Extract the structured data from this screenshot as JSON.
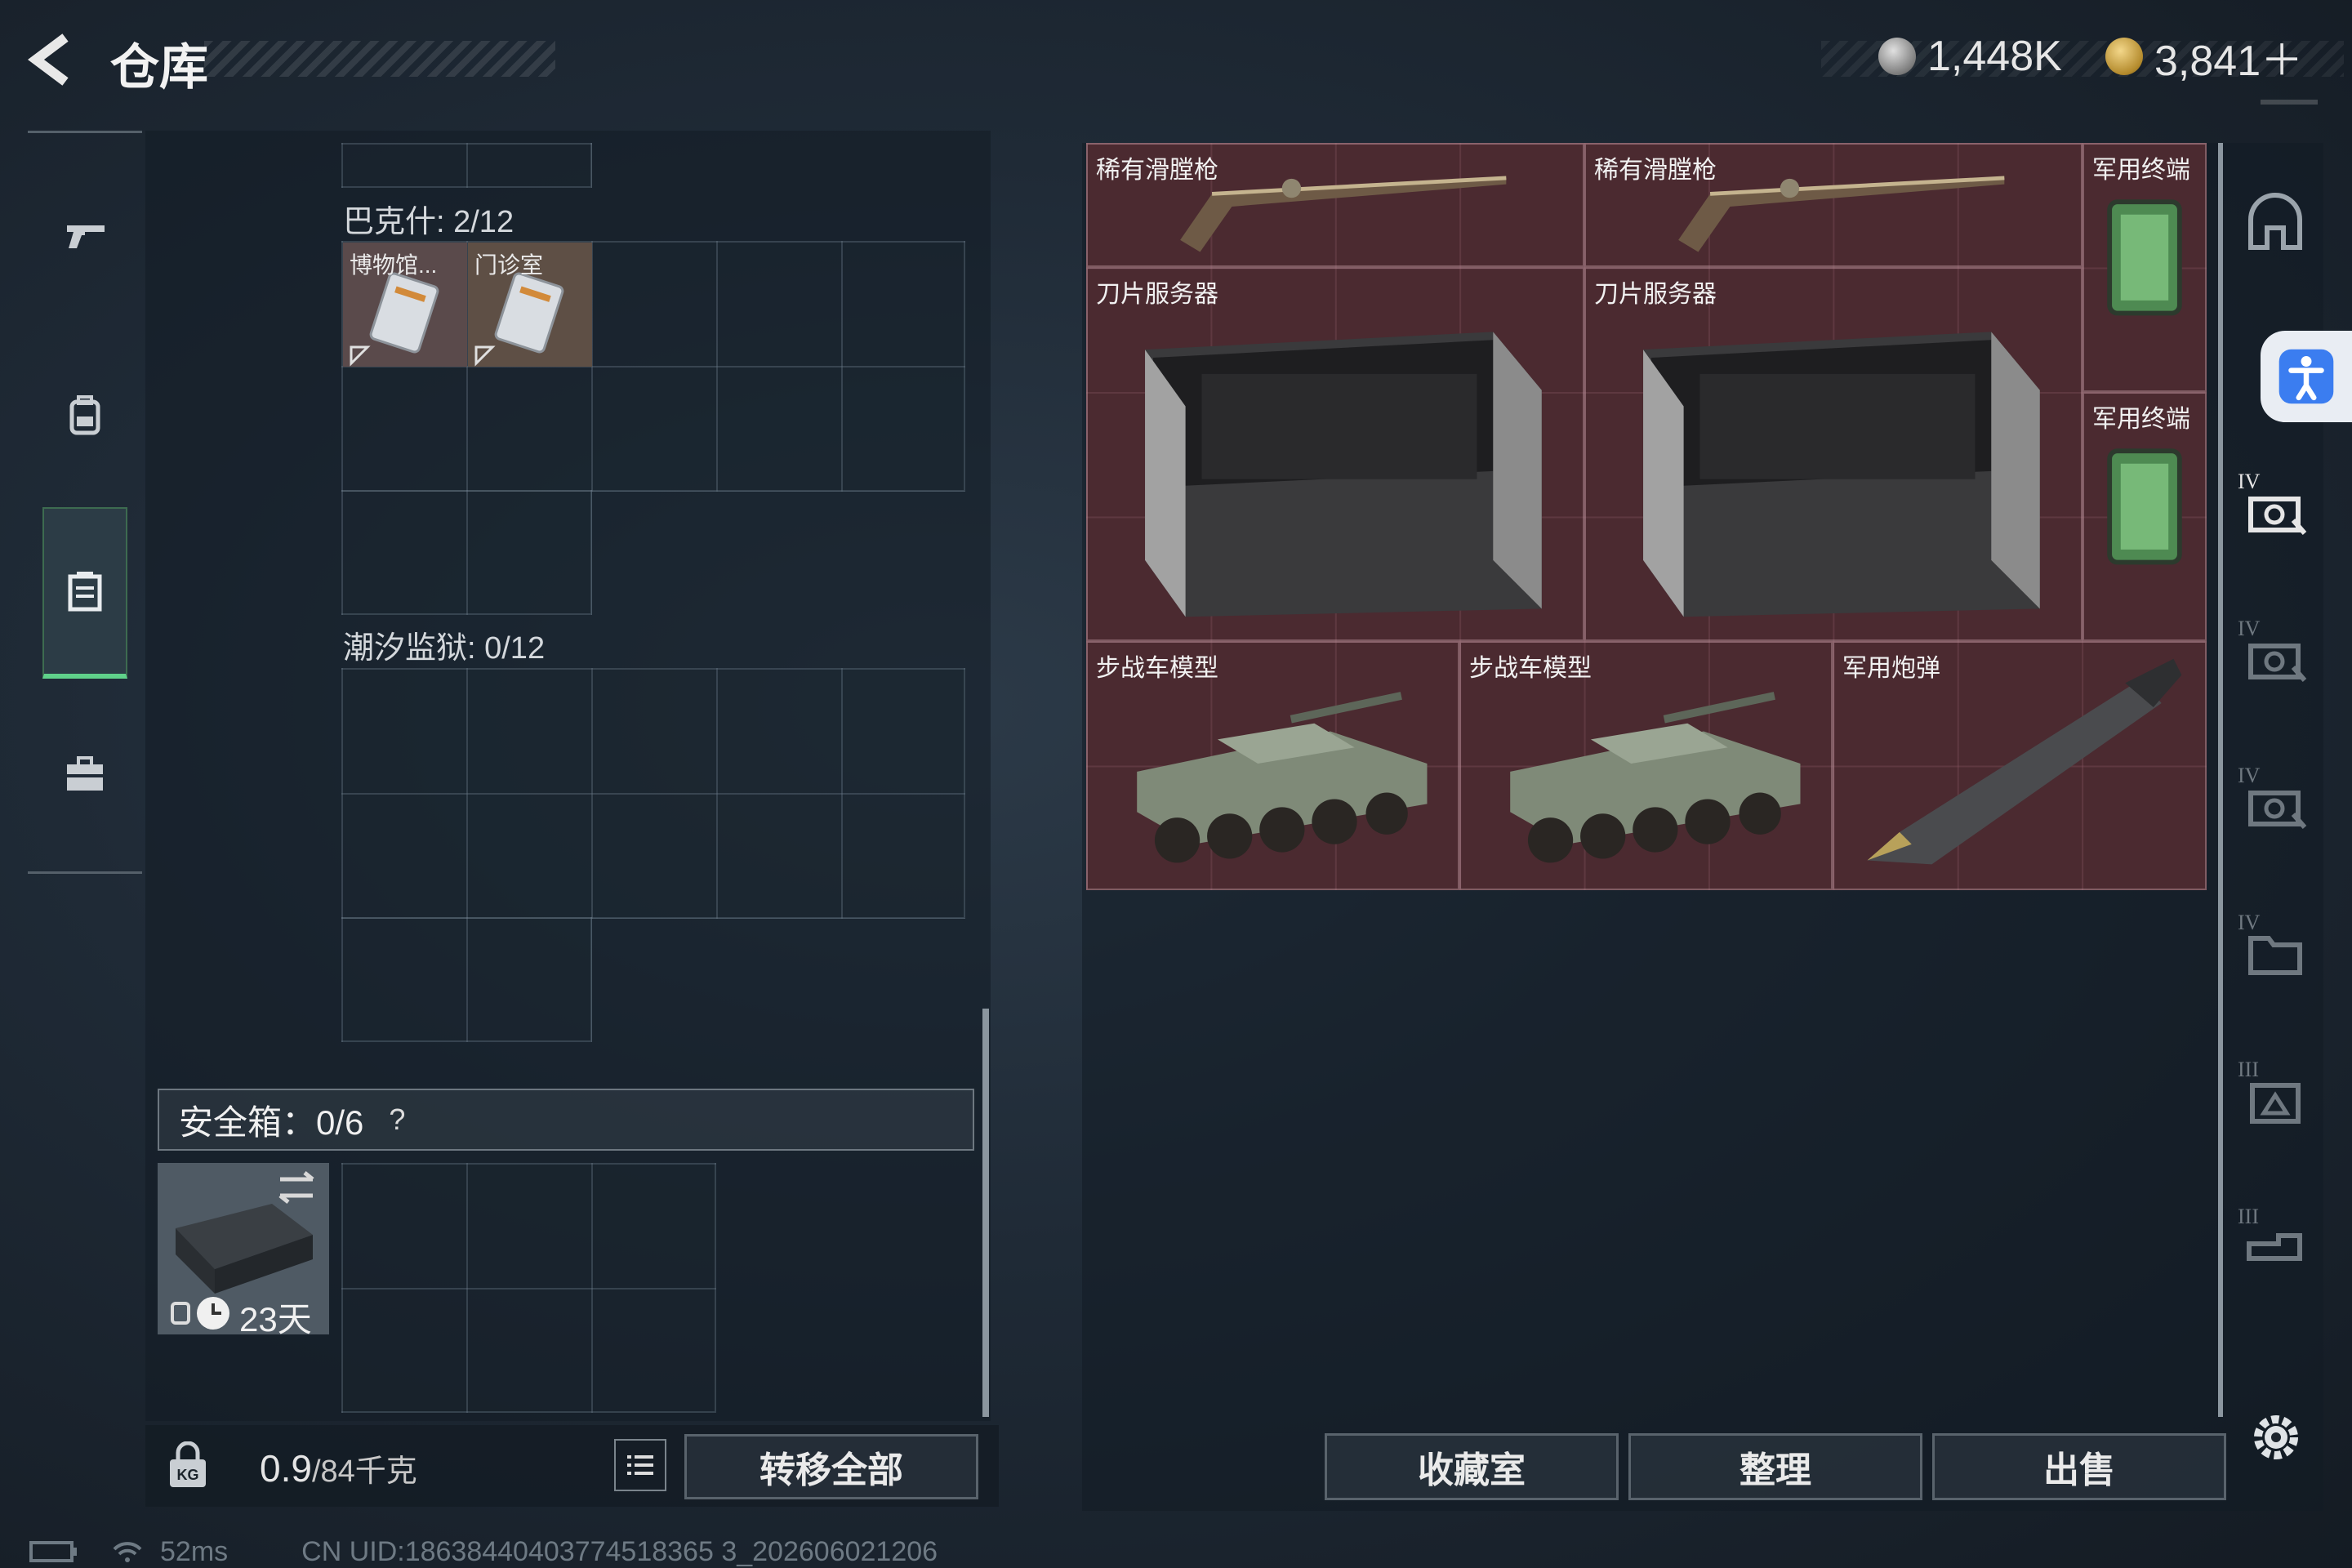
{
  "header": {
    "title": "仓库",
    "currencies": [
      {
        "icon": "silver-coin-icon",
        "value": "1,448K"
      },
      {
        "icon": "gold-coin-icon",
        "value": "3,841＋"
      }
    ]
  },
  "left_nav": {
    "items": [
      {
        "name": "weapons",
        "icon": "pistol-icon"
      },
      {
        "name": "backpack",
        "icon": "backpack-icon"
      },
      {
        "name": "containers",
        "icon": "container-icon",
        "active": true
      },
      {
        "name": "briefcase",
        "icon": "briefcase-icon"
      }
    ]
  },
  "containers": [
    {
      "label": "巴克什: 2/12",
      "items": [
        {
          "label": "博物馆...",
          "icon": "keycard-icon"
        },
        {
          "label": "门诊室",
          "icon": "keycard-icon"
        }
      ]
    },
    {
      "label": "潮汐监狱: 0/12",
      "items": []
    }
  ],
  "safe_box": {
    "label": "安全箱：0/6",
    "help": "?",
    "duration": "23天"
  },
  "weight": {
    "value": "0.9",
    "unit": "/84千克"
  },
  "buttons": {
    "transfer_all": "转移全部",
    "collection": "收藏室",
    "sort": "整理",
    "sell": "出售"
  },
  "storage_items": [
    {
      "label": "稀有滑膛枪",
      "icon": "musket-icon"
    },
    {
      "label": "稀有滑膛枪",
      "icon": "musket-icon"
    },
    {
      "label": "军用终端",
      "icon": "terminal-icon"
    },
    {
      "label": "刀片服务器",
      "icon": "blade-server-icon"
    },
    {
      "label": "刀片服务器",
      "icon": "blade-server-icon"
    },
    {
      "label": "军用终端",
      "icon": "terminal-icon"
    },
    {
      "label": "步战车模型",
      "icon": "ifv-model-icon"
    },
    {
      "label": "步战车模型",
      "icon": "ifv-model-icon"
    },
    {
      "label": "军用炮弹",
      "icon": "artillery-shell-icon"
    }
  ],
  "side_tabs": [
    {
      "tier": "",
      "icon": "helmet-tab-icon"
    },
    {
      "tier": "IV",
      "icon": "tier-tab-icon"
    },
    {
      "tier": "IV",
      "icon": "camera-tab-icon"
    },
    {
      "tier": "IV",
      "icon": "camera-tab-icon"
    },
    {
      "tier": "IV",
      "icon": "camera-tab-icon"
    },
    {
      "tier": "IV",
      "icon": "folder-tab-icon"
    },
    {
      "tier": "III",
      "icon": "crate-tab-icon"
    },
    {
      "tier": "III",
      "icon": "vehicle-tab-icon"
    }
  ],
  "status": {
    "ping": "52ms",
    "uid": "CN UID:18638440403774518365 3_202606021206"
  },
  "colors": {
    "accent_green": "#5fd18a",
    "rare_item_bg": "#4b2a30",
    "panel_bg": "#121c25"
  }
}
